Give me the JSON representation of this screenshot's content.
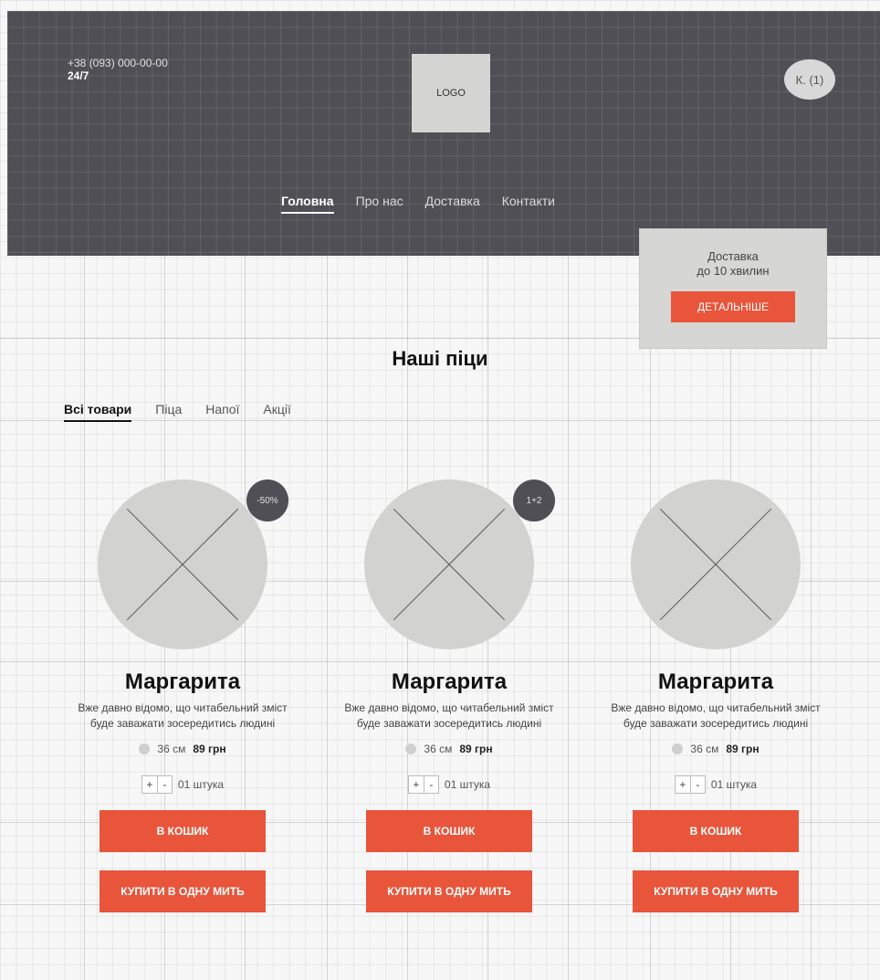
{
  "header": {
    "phone": "+38 (093) 000-00-00",
    "hours": "24/7",
    "logo": "LOGO",
    "cart_label": "К. (1)",
    "nav": [
      {
        "label": "Головна",
        "active": true
      },
      {
        "label": "Про нас",
        "active": false
      },
      {
        "label": "Доставка",
        "active": false
      },
      {
        "label": "Контакти",
        "active": false
      }
    ]
  },
  "delivery_promo": {
    "line1": "Доставка",
    "line2": "до 10 хвилин",
    "button": "ДЕТАЛЬНІШЕ"
  },
  "section_title": "Наші піци",
  "tabs": [
    {
      "label": "Всі товари",
      "active": true
    },
    {
      "label": "Піца",
      "active": false
    },
    {
      "label": "Напої",
      "active": false
    },
    {
      "label": "Акції",
      "active": false
    }
  ],
  "products": [
    {
      "name": "Маргарита",
      "description": "Вже давно відомо, що читабельний зміст буде заважати зосередитись людині",
      "size": "36 см",
      "price": "89 грн",
      "quantity": "01 штука",
      "badge": "-50%",
      "add_to_cart": "В КОШИК",
      "buy_now": "КУПИТИ В ОДНУ МИТЬ"
    },
    {
      "name": "Маргарита",
      "description": "Вже давно відомо, що читабельний зміст буде заважати зосередитись людині",
      "size": "36 см",
      "price": "89 грн",
      "quantity": "01 штука",
      "badge": "1+2",
      "add_to_cart": "В КОШИК",
      "buy_now": "КУПИТИ В ОДНУ МИТЬ"
    },
    {
      "name": "Маргарита",
      "description": "Вже давно відомо, що читабельний зміст буде заважати зосередитись людині",
      "size": "36 см",
      "price": "89 грн",
      "quantity": "01 штука",
      "badge": "",
      "add_to_cart": "В КОШИК",
      "buy_now": "КУПИТИ В ОДНУ МИТЬ"
    }
  ],
  "stepper": {
    "plus": "+",
    "minus": "-"
  },
  "colors": {
    "header_bg": "#4f4f55",
    "accent": "#e8553b",
    "placeholder": "#d2d2d0"
  }
}
